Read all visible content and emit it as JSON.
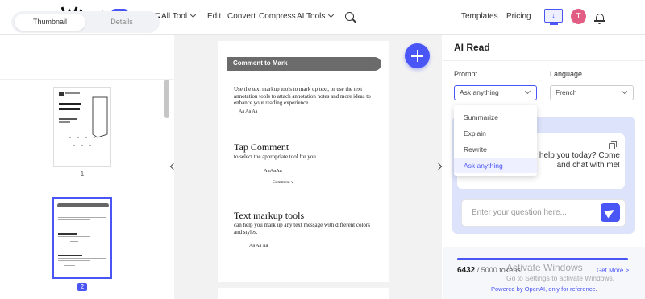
{
  "brand": {
    "wondershare": "wondershare",
    "product": "HiPDF"
  },
  "nav": {
    "all_tool": "All Tool",
    "edit": "Edit",
    "convert": "Convert",
    "compress": "Compress",
    "ai_tools": "AI Tools",
    "templates": "Templates",
    "pricing": "Pricing"
  },
  "user": {
    "avatar_initial": "T"
  },
  "left_panel": {
    "tabs": [
      "Thumbnail",
      "Details"
    ],
    "active_tab": "Thumbnail",
    "pages": [
      "1",
      "2"
    ],
    "current_page": "2"
  },
  "document": {
    "banner": "Comment to Mark",
    "para1": "Use the text markup tools to mark up text, or use the text annotation tools to attach annotation notes and more ideas to enhance your reading experience.",
    "samples": "Aa  Aa  Aa",
    "heading1": "Tap Comment",
    "para2": "to select the appropriate tool for you.",
    "sample2": "AaAaAa",
    "sample3": "Comment v",
    "heading2": "Text markup tools",
    "para3": "can help you mark up any text message with different colors and styles.",
    "sample4": "Aa  Aa  Aa"
  },
  "ai_read": {
    "title": "AI Read",
    "prompt_label": "Prompt",
    "prompt_value": "Ask anything",
    "language_label": "Language",
    "language_value": "French",
    "prompt_options": [
      "Summarize",
      "Explain",
      "Rewrite",
      "Ask anything"
    ],
    "selected_option": "Ask anything",
    "assistant_message": "tant, powered by help you today? Come and chat with me!",
    "question_placeholder": "Enter your question here...",
    "tokens_used": "6432",
    "tokens_total": "/ 5000 tokens",
    "token_progress": 1.0,
    "get_more": "Get More >",
    "powered_by": "Powered by OpenAI, only for reference."
  },
  "watermark": {
    "line1": "Activate Windows",
    "line2": "Go to Settings to activate Windows."
  },
  "colors": {
    "accent": "#4a55f5",
    "avatar": "#e25d83",
    "chat_bg": "#dde3fb"
  }
}
